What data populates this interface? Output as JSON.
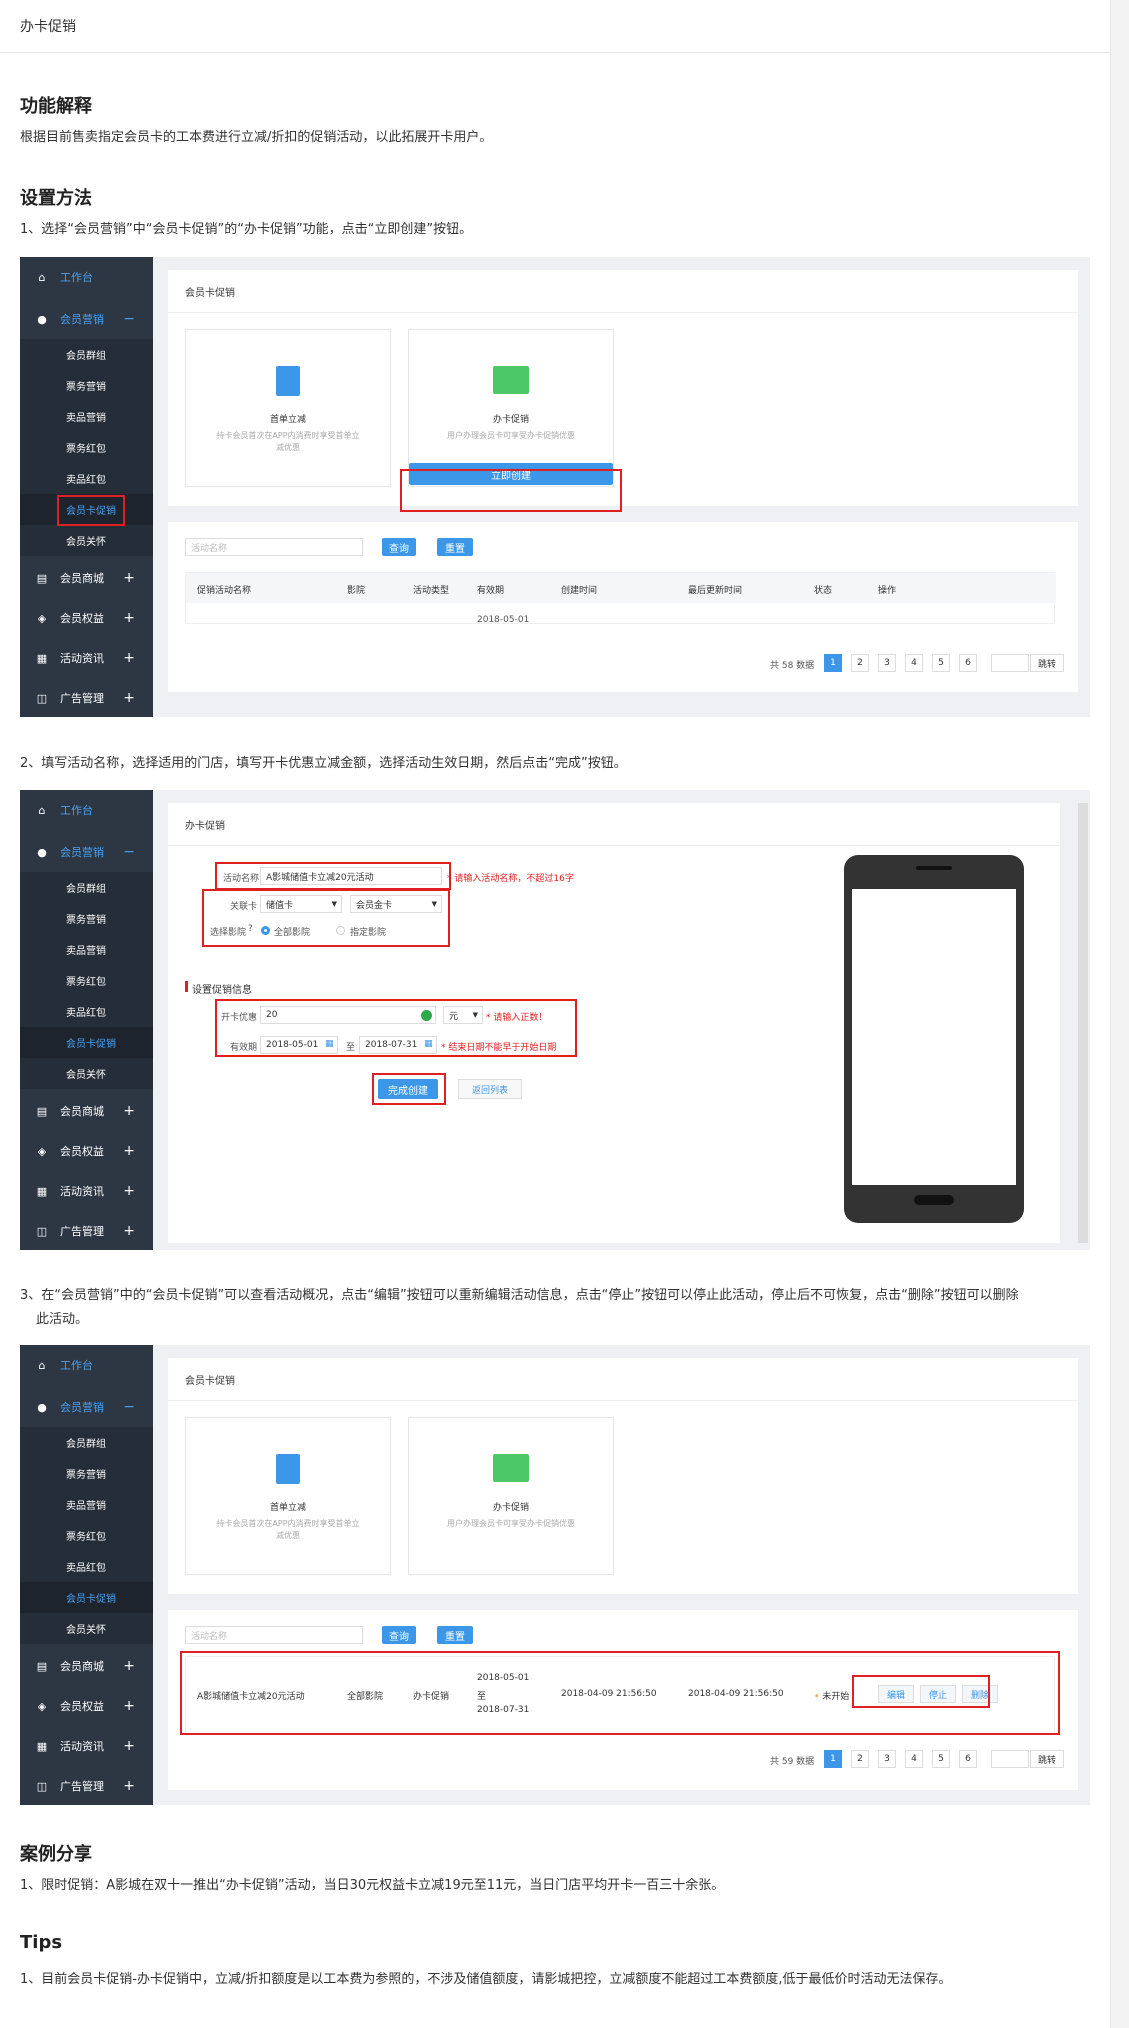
{
  "page_title": "办卡促销",
  "sec1": {
    "title": "功能解释",
    "text": "根据目前售卖指定会员卡的工本费进行立减/折扣的促销活动，以此拓展开卡用户。"
  },
  "sec2": {
    "title": "设置方法",
    "step1": "1、选择“会员营销”中“会员卡促销”的“办卡促销”功能，点击“立即创建”按钮。",
    "step2": "2、填写活动名称，选择适用的门店，填写开卡优惠立减金额，选择活动生效日期，然后点击“完成”按钮。",
    "step3": "3、在“会员营销”中的“会员卡促销”可以查看活动概况，点击“编辑”按钮可以重新编辑活动信息，点击“停止”按钮可以停止此活动，停止后不可恢复，点击“删除”按钮可以删除",
    "step3b": "此活动。"
  },
  "sidebar": {
    "workbench": "工作台",
    "member_marketing": "会员营销",
    "subs": [
      "会员群组",
      "票务营销",
      "卖品营销",
      "票务红包",
      "卖品红包",
      "会员卡促销",
      "会员关怀"
    ],
    "mall": "会员商城",
    "rights": "会员权益",
    "news": "活动资讯",
    "ads": "广告管理"
  },
  "shot1": {
    "header": "会员卡促销",
    "card1_title": "首单立减",
    "card1_desc1": "持卡会员首次在APP内消费时享受首单立",
    "card1_desc2": "减优惠",
    "card2_title": "办卡促销",
    "card2_desc": "用户办理会员卡可享受办卡促销优惠",
    "create_btn": "立即创建",
    "search_ph": "活动名称",
    "query": "查询",
    "reset": "重置",
    "cols": [
      "促销活动名称",
      "影院",
      "活动类型",
      "有效期",
      "创建时间",
      "最后更新时间",
      "状态",
      "操作"
    ],
    "partial": "2018-05-01",
    "total": "共 58 数据",
    "pages": [
      "1",
      "2",
      "3",
      "4",
      "5",
      "6"
    ],
    "jump": "跳转"
  },
  "shot2": {
    "header": "办卡促销",
    "name_label": "活动名称",
    "name_value": "A影城储值卡立减20元活动",
    "name_hint": "* 请输入活动名称，不超过16字",
    "card_label": "关联卡",
    "card_type": "储值卡",
    "card_name": "会员金卡",
    "cinema_label": "选择影院",
    "all_cinema": "全部影院",
    "spec_cinema": "指定影院",
    "section": "设置促销信息",
    "discount_label": "开卡优惠",
    "discount_value": "20",
    "unit": "元",
    "discount_hint": "* 请输入正数！",
    "valid_label": "有效期",
    "start": "2018-05-01",
    "to": "至",
    "end": "2018-07-31",
    "date_hint": "* 结束日期不能早于开始日期",
    "done": "完成创建",
    "back": "返回列表"
  },
  "shot3": {
    "row": {
      "name": "A影城储值卡立减20元活动",
      "cinema": "全部影院",
      "type": "办卡促销",
      "d1": "2018-05-01",
      "d2": "至",
      "d3": "2018-07-31",
      "created": "2018-04-09 21:56:50",
      "updated": "2018-04-09 21:56:50",
      "status": "未开始",
      "edit": "编辑",
      "stop": "停止",
      "delete": "删除"
    },
    "total": "共 59 数据"
  },
  "sec3": {
    "title": "案例分享",
    "text": "1、限时促销：A影城在双十一推出“办卡促销”活动，当日30元权益卡立减19元至11元，当日门店平均开卡一百三十余张。"
  },
  "sec4": {
    "title": "Tips",
    "text": "1、目前会员卡促销-办卡促销中，立减/折扣额度是以工本费为参照的，不涉及储值额度，请影城把控，立减额度不能超过工本费额度,低于最低价时活动无法保存。"
  }
}
